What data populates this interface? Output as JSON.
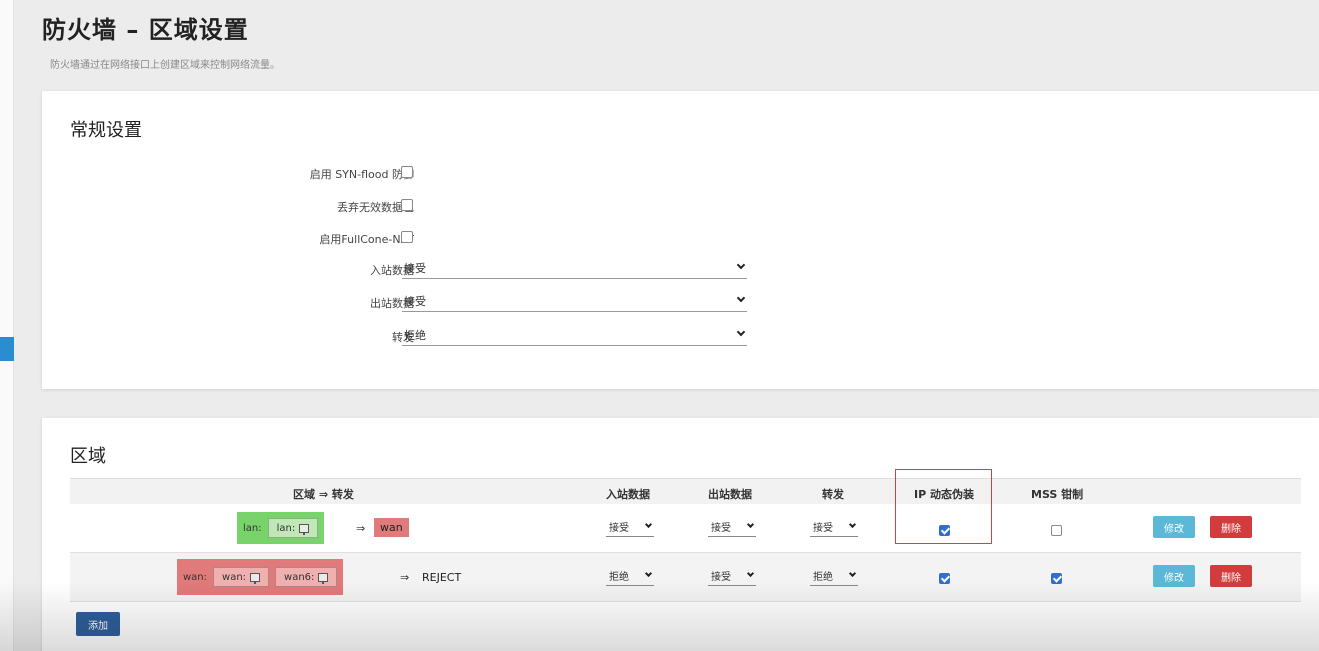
{
  "page": {
    "title": "防火墙 – 区域设置",
    "description": "防火墙通过在网络接口上创建区域来控制网络流量。"
  },
  "general": {
    "title": "常规设置",
    "syn_flood_label": "启用 SYN-flood 防御",
    "syn_flood_checked": false,
    "drop_invalid_label": "丢弃无效数据包",
    "drop_invalid_checked": false,
    "fullcone_label": "启用FullCone-NAT",
    "fullcone_checked": false,
    "input_label": "入站数据",
    "input_value": "接受",
    "output_label": "出站数据",
    "output_value": "接受",
    "forward_label": "转发",
    "forward_value": "拒绝"
  },
  "zones": {
    "title": "区域",
    "headers": {
      "zone_forward": "区域 ⇒ 转发",
      "input": "入站数据",
      "output": "出站数据",
      "forward": "转发",
      "masq": "IP 动态伪装",
      "mss": "MSS 钳制"
    },
    "arrow": "⇒",
    "rows": [
      {
        "zone": "lan:",
        "interfaces": [
          "lan:"
        ],
        "dest": "wan",
        "input": "接受",
        "output": "接受",
        "forward": "接受",
        "masq": true,
        "mss": false
      },
      {
        "zone": "wan:",
        "interfaces": [
          "wan:",
          "wan6:"
        ],
        "dest": "REJECT",
        "input": "拒绝",
        "output": "接受",
        "forward": "拒绝",
        "masq": true,
        "mss": true
      }
    ],
    "edit_label": "修改",
    "delete_label": "删除",
    "add_label": "添加"
  },
  "colors": {
    "lan_zone": "#78d36a",
    "wan_zone": "#e17a7a",
    "edit_button": "#5bb8d6",
    "delete_button": "#d23c3c",
    "add_button": "#2e5f9a",
    "highlight": "#d84040"
  },
  "icons": {
    "interface": "network-port-icon",
    "select": "chevron-down-icon"
  }
}
